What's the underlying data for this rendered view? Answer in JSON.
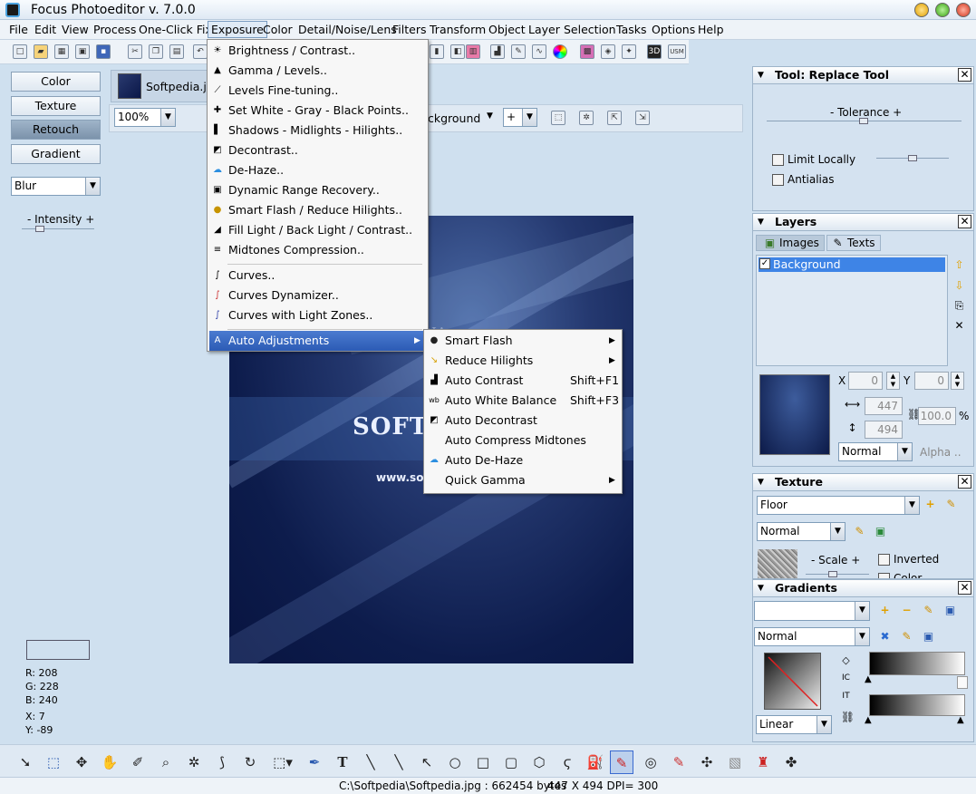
{
  "window": {
    "title": "Focus Photoeditor v. 7.0.0"
  },
  "menubar": {
    "items": [
      "File",
      "Edit",
      "View",
      "Process",
      "One-Click Fix",
      "Exposure",
      "Color",
      "Detail/Noise/Lens",
      "Filters",
      "Transform",
      "Object",
      "Layer",
      "Selection",
      "Tasks",
      "Options",
      "Help"
    ],
    "active": "Exposure"
  },
  "left_panel": {
    "buttons": [
      "Color",
      "Texture",
      "Retouch",
      "Gradient"
    ],
    "active_button": "Retouch",
    "tool_select": "Blur",
    "slider_label": "- Intensity +",
    "intensity": 0.25,
    "pixel_info": {
      "r": "R: 208",
      "g": "G: 228",
      "b": "B: 240",
      "x": "X: 7",
      "y": "Y: -89"
    }
  },
  "document": {
    "tab_name": "Softpedia.jpg",
    "zoom": "100%",
    "bg_label": "ckground",
    "blend_op": "+",
    "image_text": "SOFTI",
    "image_url": "www.soft",
    "watermark": "SOFTPEDIA"
  },
  "exposure_menu": {
    "items": [
      {
        "label": "Brightness / Contrast..",
        "icon": "brightness-icon"
      },
      {
        "label": "Gamma / Levels..",
        "icon": "gamma-icon"
      },
      {
        "label": "Levels Fine-tuning..",
        "icon": "levels-icon"
      },
      {
        "label": "Set White - Gray - Black Points..",
        "icon": "points-icon"
      },
      {
        "label": "Shadows - Midlights - Hilights..",
        "icon": "shadows-icon"
      },
      {
        "label": "Decontrast..",
        "icon": "decontrast-icon"
      },
      {
        "label": "De-Haze..",
        "icon": "cloud-icon"
      },
      {
        "label": "Dynamic Range Recovery..",
        "icon": "range-icon"
      },
      {
        "label": "Smart Flash / Reduce Hilights..",
        "icon": "flash-icon"
      },
      {
        "label": "Fill Light / Back Light / Contrast..",
        "icon": "filllight-icon"
      },
      {
        "label": "Midtones Compression..",
        "icon": "midtones-icon"
      },
      {
        "label": "Curves..",
        "icon": "curves-icon"
      },
      {
        "label": "Curves Dynamizer..",
        "icon": "curves-dyn-icon"
      },
      {
        "label": "Curves with Light Zones..",
        "icon": "curves-zones-icon"
      },
      {
        "label": "Auto Adjustments",
        "icon": "auto-icon"
      }
    ],
    "highlighted": "Auto Adjustments"
  },
  "auto_submenu": {
    "items": [
      {
        "label": "Smart Flash",
        "shortcut": "",
        "arrow": true
      },
      {
        "label": "Reduce Hilights",
        "shortcut": "",
        "arrow": true
      },
      {
        "label": "Auto Contrast",
        "shortcut": "Shift+F1",
        "arrow": false
      },
      {
        "label": "Auto White Balance",
        "shortcut": "Shift+F3",
        "arrow": false
      },
      {
        "label": "Auto Decontrast",
        "shortcut": "",
        "arrow": false
      },
      {
        "label": "Auto Compress Midtones",
        "shortcut": "",
        "arrow": false
      },
      {
        "label": "Auto De-Haze",
        "shortcut": "",
        "arrow": false
      },
      {
        "label": "Quick Gamma",
        "shortcut": "",
        "arrow": true
      }
    ]
  },
  "tool_panel": {
    "title": "Tool: Replace Tool",
    "tolerance_label": "- Tolerance +",
    "limit_locally": "Limit Locally",
    "antialias": "Antialias"
  },
  "layers_panel": {
    "title": "Layers",
    "tabs": [
      "Images",
      "Texts"
    ],
    "layer_name": "Background",
    "x_label": "X",
    "x": "0",
    "y_label": "Y",
    "y": "0",
    "width": "447",
    "height": "494",
    "opacity": "100.0",
    "percent": "%",
    "blend": "Normal",
    "alpha": "Alpha .."
  },
  "texture_panel": {
    "title": "Texture",
    "texture": "Floor",
    "blend": "Normal",
    "scale_label": "- Scale +",
    "inverted": "Inverted",
    "color": "Color"
  },
  "gradients_panel": {
    "title": "Gradients",
    "blend": "Normal",
    "type": "Linear"
  },
  "statusbar": {
    "file": "C:\\Softpedia\\Softpedia.jpg : 662454 bytes",
    "info": "447 X 494 DPI= 300"
  }
}
